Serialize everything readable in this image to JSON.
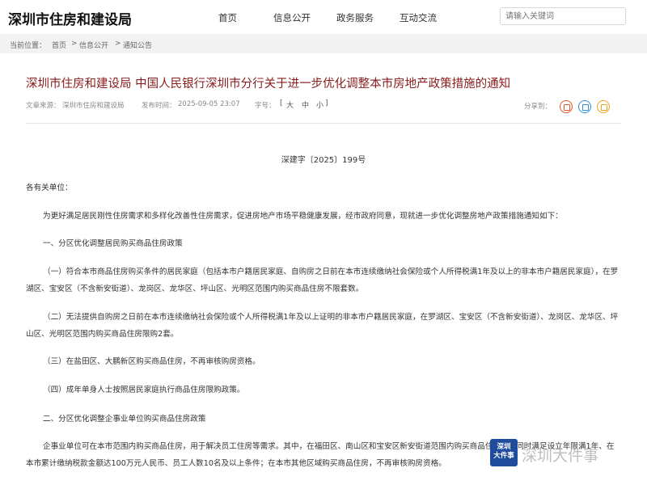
{
  "site": {
    "logo": "深圳市住房和建设局"
  },
  "nav": [
    {
      "label": "首页"
    },
    {
      "label": "信息公开"
    },
    {
      "label": "政务服务"
    },
    {
      "label": "互动交流"
    }
  ],
  "search": {
    "placeholder": "请输入关键词"
  },
  "breadcrumb": {
    "prefix": "当前位置：",
    "items": [
      "首页",
      "信息公开",
      "通知公告"
    ],
    "separator": ">"
  },
  "article": {
    "title": "深圳市住房和建设局 中国人民银行深圳市分行关于进一步优化调整本市房地产政策措施的通知",
    "source_label": "文章来源：",
    "source": "深圳市住房和建设局",
    "time_label": "发布时间：",
    "time": "2025-09-05 23:07",
    "fontsize_label": "字号：",
    "fontsize_options": [
      "大",
      "中",
      "小"
    ],
    "share_label": "分享到：",
    "doc_number": "深建字〔2025〕199号",
    "paragraphs": [
      "各有关单位：",
      "为更好满足居民刚性住房需求和多样化改善性住房需求，促进房地产市场平稳健康发展，经市政府同意，现就进一步优化调整房地产政策措施通知如下：",
      "一、分区优化调整居民购买商品住房政策",
      "（一）符合本市商品住房购买条件的居民家庭（包括本市户籍居民家庭、自购房之日前在本市连续缴纳社会保险或个人所得税满1年及以上的非本市户籍居民家庭），在罗湖区、宝安区（不含新安街道）、龙岗区、龙华区、坪山区、光明区范围内购买商品住房不限套数。",
      "（二）无法提供自购房之日前在本市连续缴纳社会保险或个人所得税满1年及以上证明的非本市户籍居民家庭，在罗湖区、宝安区（不含新安街道）、龙岗区、龙华区、坪山区、光明区范围内购买商品住房限购2套。",
      "（三）在盐田区、大鹏新区购买商品住房，不再审核购房资格。",
      "（四）成年单身人士按照居民家庭执行商品住房限购政策。",
      "二、分区优化调整企事业单位购买商品住房政策",
      "企事业单位可在本市范围内购买商品住房，用于解决员工住房等需求。其中，在福田区、南山区和宝安区新安街道范围内购买商品住房，需同时满足设立年限满1年、在本市累计缴纳税款金额达100万元人民币、员工人数10名及以上条件；在本市其他区域购买商品住房，不再审核购房资格。"
    ]
  },
  "watermark": {
    "badge": "深圳\n大件事",
    "text": "深圳大件事"
  },
  "colors": {
    "title": "#8a1b1b",
    "share_wechat": "#e8542c",
    "share_weibo": "#2d8fdd",
    "share_qzone": "#f0a31c"
  }
}
